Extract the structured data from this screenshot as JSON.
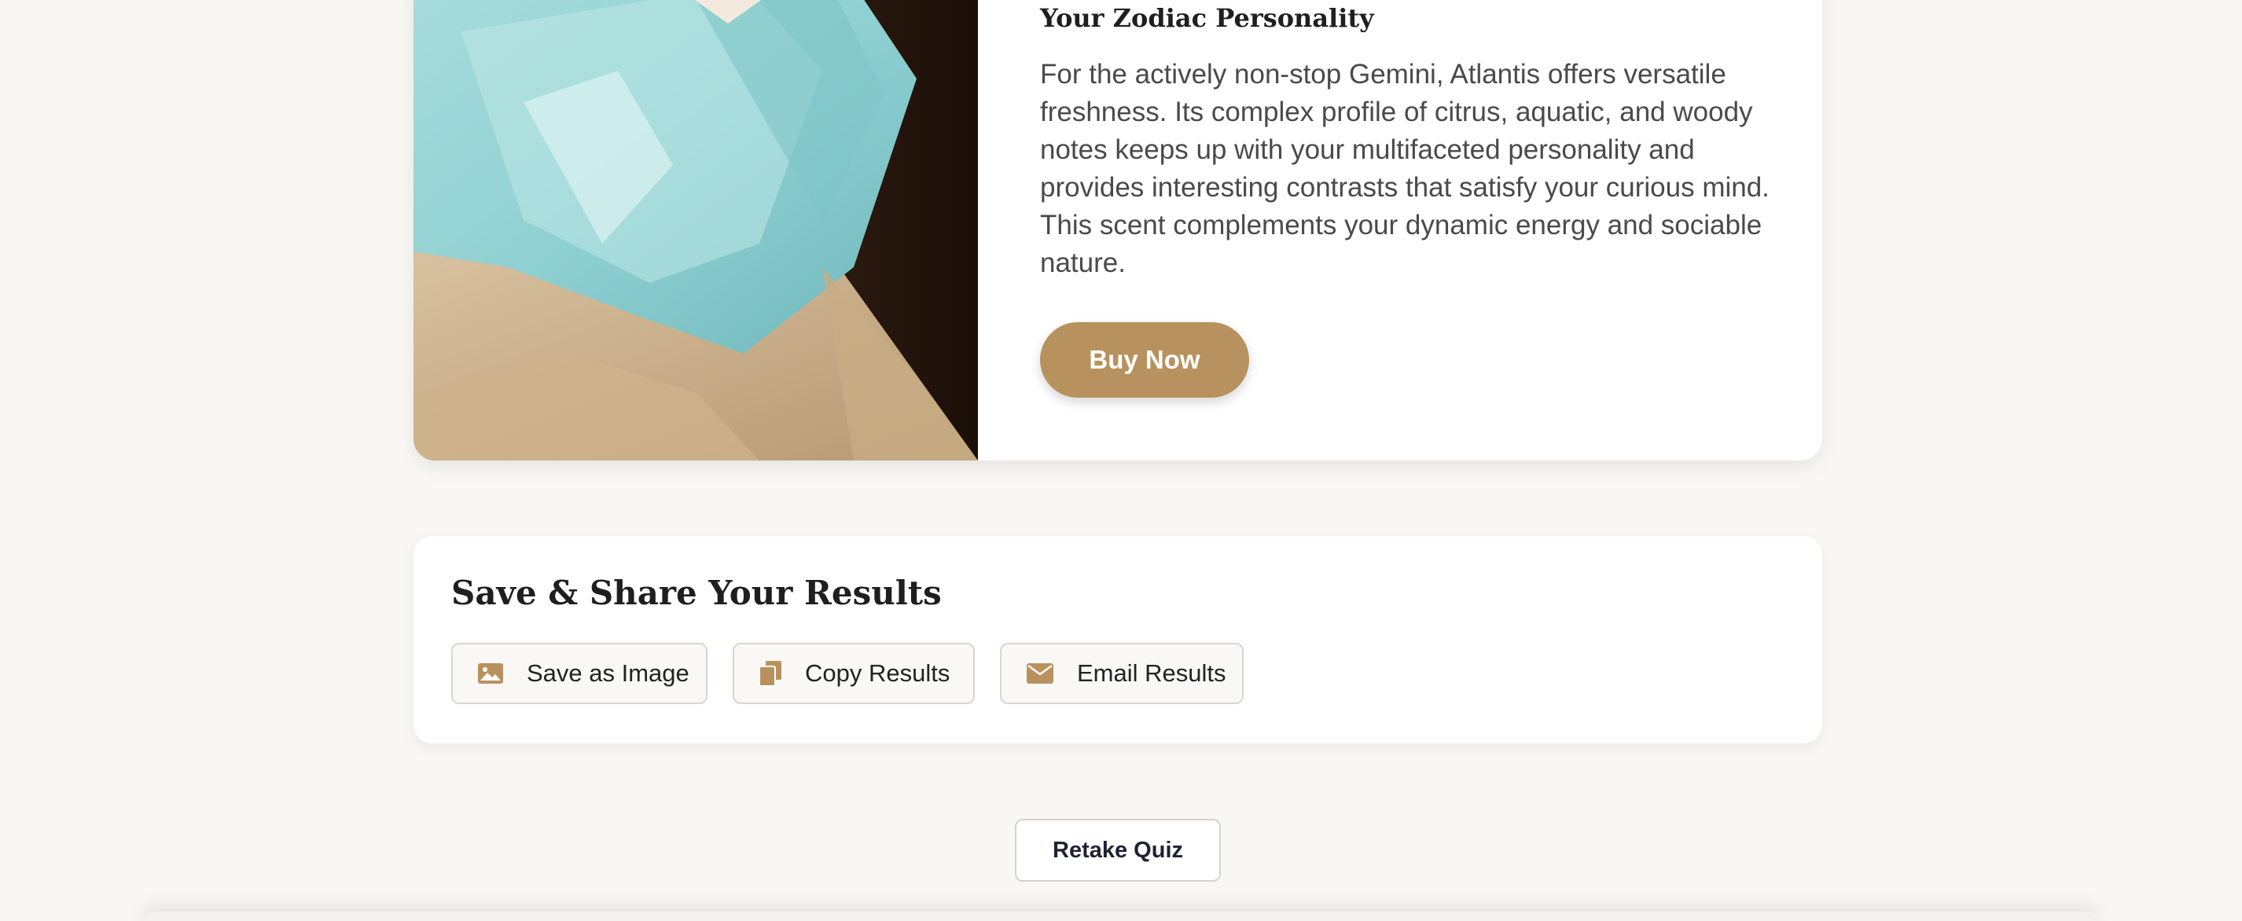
{
  "result": {
    "image_alt": "Atlantis perfume bottle on sand",
    "personality_heading": "Your Zodiac Personality",
    "personality_text": "For the actively non-stop Gemini, Atlantis offers versatile freshness. Its complex profile of citrus, aquatic, and woody notes keeps up with your multifaceted personality and provides interesting contrasts that satisfy your curious mind. This scent complements your dynamic energy and sociable nature.",
    "buy_label": "Buy Now"
  },
  "share": {
    "title": "Save & Share Your Results",
    "buttons": [
      {
        "label": "Save as Image",
        "icon": "image-icon"
      },
      {
        "label": "Copy Results",
        "icon": "copy-icon"
      },
      {
        "label": "Email Results",
        "icon": "envelope-icon"
      }
    ]
  },
  "retake_label": "Retake Quiz",
  "colors": {
    "accent": "#b8925e",
    "background": "#f8f7f3",
    "card": "#ffffff"
  }
}
